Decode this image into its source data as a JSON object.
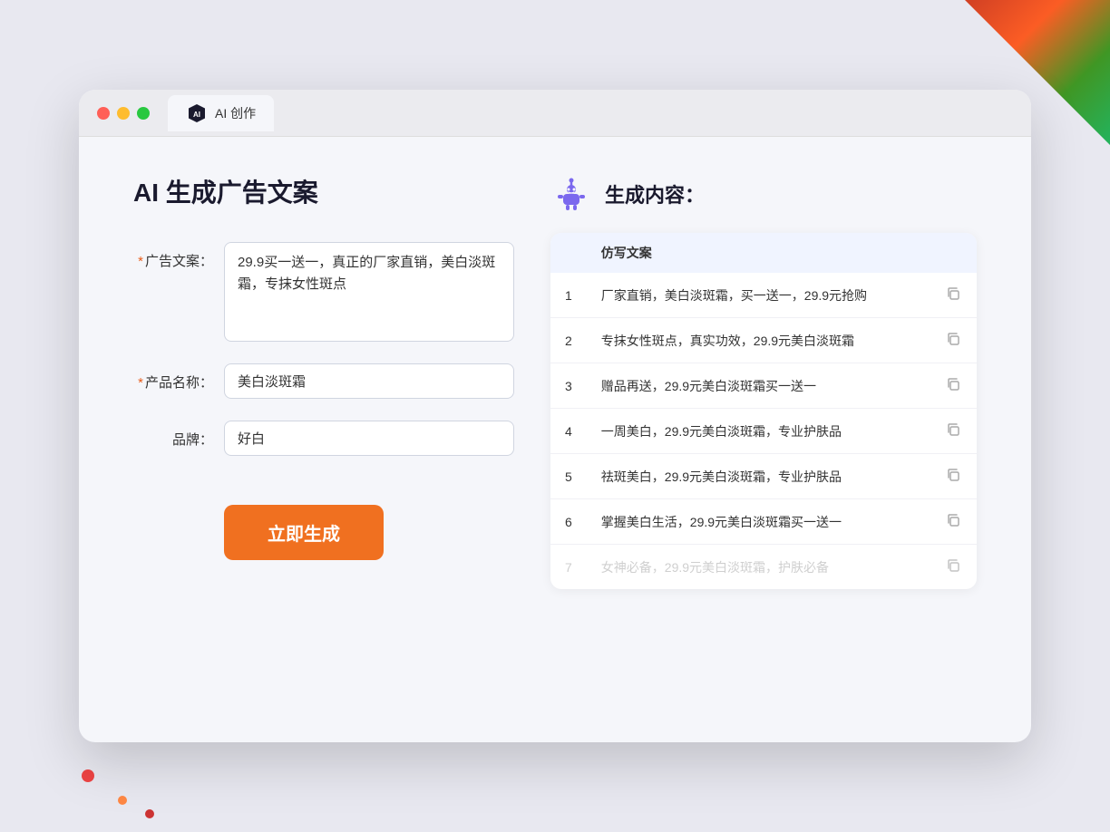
{
  "browser": {
    "tab_label": "AI 创作",
    "ai_icon_text": "AI"
  },
  "left_panel": {
    "title": "AI 生成广告文案",
    "ad_label": "广告文案：",
    "ad_required": "*",
    "ad_value": "29.9买一送一，真正的厂家直销，美白淡斑霜，专抹女性斑点",
    "product_label": "产品名称：",
    "product_required": "*",
    "product_value": "美白淡斑霜",
    "brand_label": "品牌：",
    "brand_value": "好白",
    "generate_button": "立即生成"
  },
  "right_panel": {
    "result_title": "生成内容：",
    "col_header": "仿写文案",
    "results": [
      {
        "num": "1",
        "text": "厂家直销，美白淡斑霜，买一送一，29.9元抢购"
      },
      {
        "num": "2",
        "text": "专抹女性斑点，真实功效，29.9元美白淡斑霜"
      },
      {
        "num": "3",
        "text": "赠品再送，29.9元美白淡斑霜买一送一"
      },
      {
        "num": "4",
        "text": "一周美白，29.9元美白淡斑霜，专业护肤品"
      },
      {
        "num": "5",
        "text": "祛斑美白，29.9元美白淡斑霜，专业护肤品"
      },
      {
        "num": "6",
        "text": "掌握美白生活，29.9元美白淡斑霜买一送一"
      },
      {
        "num": "7",
        "text": "女神必备，29.9元美白淡斑霜，护肤必备",
        "faded": true
      }
    ]
  }
}
